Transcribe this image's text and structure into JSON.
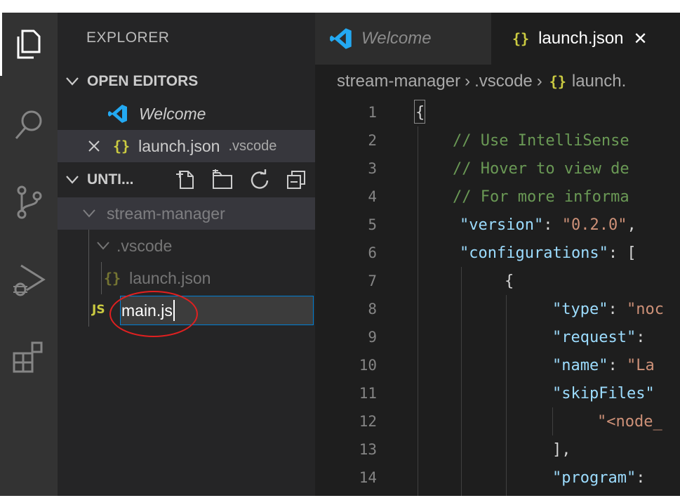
{
  "sidebar": {
    "title": "EXPLORER",
    "open_editors": {
      "label": "OPEN EDITORS",
      "items": [
        {
          "name": "Welcome"
        },
        {
          "name": "launch.json",
          "desc": ".vscode"
        }
      ]
    },
    "workspace": {
      "label": "UNTI...",
      "tree": {
        "folder": "stream-manager",
        "subfolder": ".vscode",
        "file": "launch.json",
        "new_file_badge": "JS",
        "new_file_value": "main.js"
      }
    }
  },
  "editor": {
    "tabs": [
      {
        "label": "Welcome",
        "active": false
      },
      {
        "label": "launch.json",
        "active": true,
        "close": "✕"
      }
    ],
    "breadcrumb": {
      "items": [
        "stream-manager",
        ".vscode",
        "launch."
      ],
      "separator": "›"
    },
    "lines": [
      {
        "n": "1",
        "text": "{"
      },
      {
        "n": "2",
        "text": "    // Use IntelliSense"
      },
      {
        "n": "3",
        "text": "    // Hover to view de"
      },
      {
        "n": "4",
        "text": "    // For more informa"
      },
      {
        "n": "5",
        "key": "\"version\"",
        "rest": ": ",
        "val": "\"0.2.0\"",
        "tail": ","
      },
      {
        "n": "6",
        "key": "\"configurations\"",
        "rest": ": ["
      },
      {
        "n": "7",
        "text": "{"
      },
      {
        "n": "8",
        "key": "\"type\"",
        "rest": ": ",
        "val": "\"noc"
      },
      {
        "n": "9",
        "key": "\"request\"",
        "rest": ": "
      },
      {
        "n": "10",
        "key": "\"name\"",
        "rest": ": ",
        "val": "\"La"
      },
      {
        "n": "11",
        "key": "\"skipFiles\"",
        "rest": " "
      },
      {
        "n": "12",
        "val": "\"<node_"
      },
      {
        "n": "13",
        "text": "],"
      },
      {
        "n": "14",
        "key": "\"program\"",
        "rest": ": "
      }
    ]
  },
  "colors": {
    "accent": "#007fd4",
    "annotation": "#e02020",
    "json_icon": "#cbcb41",
    "vscode_blue": "#23a9f2"
  }
}
